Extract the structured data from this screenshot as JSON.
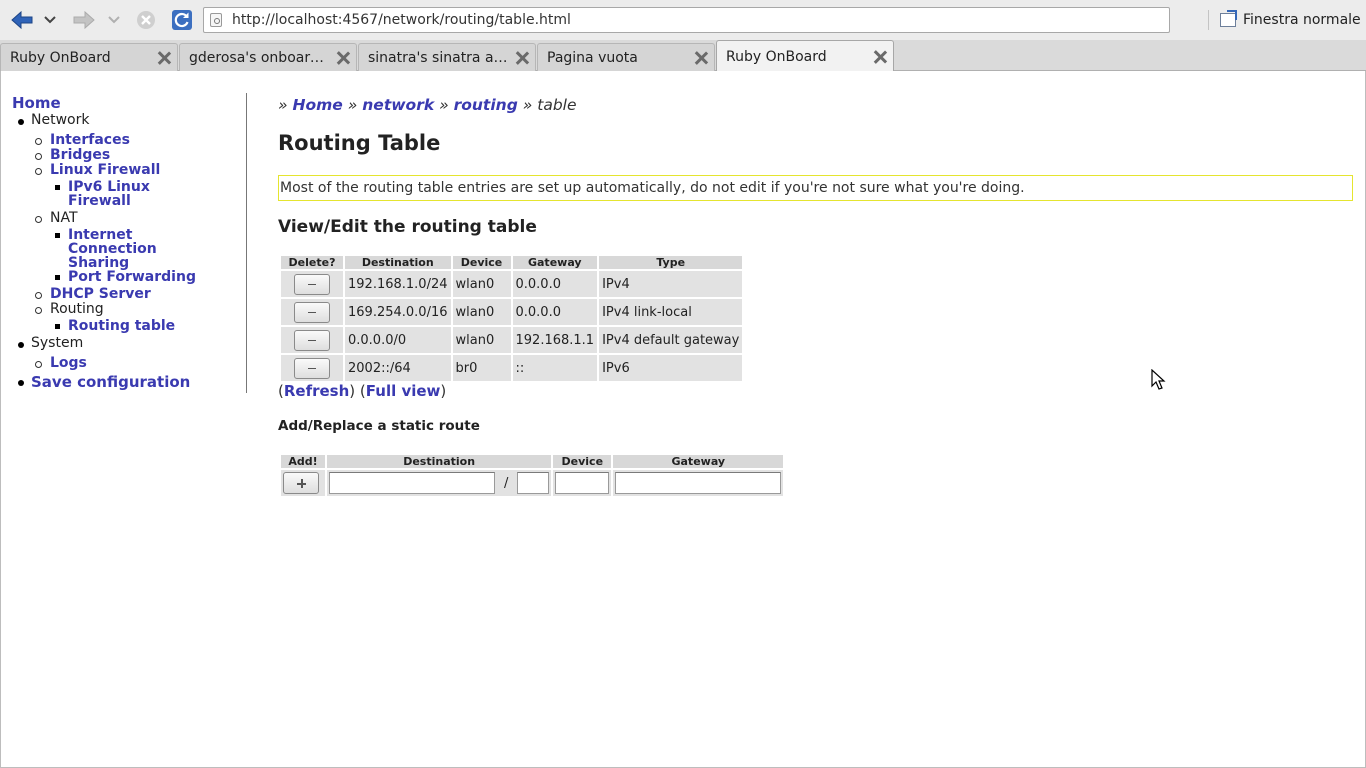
{
  "browser": {
    "url": "http://localhost:4567/network/routing/table.html",
    "window_mode_label": "Finestra normale",
    "tabs": [
      {
        "title": "Ruby OnBoard",
        "active": false
      },
      {
        "title": "gderosa's onboard at master - GitHub",
        "active": false
      },
      {
        "title": "sinatra's sinatra at master - GitHub",
        "active": false
      },
      {
        "title": "Pagina vuota",
        "active": false
      },
      {
        "title": "Ruby OnBoard",
        "active": true
      }
    ]
  },
  "sidebar": {
    "home": "Home",
    "network": "Network",
    "interfaces": "Interfaces",
    "bridges": "Bridges",
    "linux_firewall": "Linux Firewall",
    "ipv6_firewall_1": "IPv6 Linux",
    "ipv6_firewall_2": "Firewall",
    "nat": "NAT",
    "ics_1": "Internet",
    "ics_2": "Connection",
    "ics_3": "Sharing",
    "port_forwarding": "Port Forwarding",
    "dhcp_server": "DHCP Server",
    "routing": "Routing",
    "routing_table": "Routing table",
    "system": "System",
    "logs": "Logs",
    "save_configuration": "Save configuration"
  },
  "breadcrumb": {
    "sep": "»",
    "home": "Home",
    "network": "network",
    "routing": "routing",
    "current": "table"
  },
  "main": {
    "title": "Routing Table",
    "notice": "Most of the routing table entries are set up automatically, do not edit if you're not sure what you're doing.",
    "view_edit_title": "View/Edit the routing table",
    "refresh_label": "Refresh",
    "full_view_label": "Full view",
    "add_title": "Add/Replace a static route"
  },
  "routing_table": {
    "headers": [
      "Delete?",
      "Destination",
      "Device",
      "Gateway",
      "Type"
    ],
    "rows": [
      {
        "destination": "192.168.1.0/24",
        "device": "wlan0",
        "gateway": "0.0.0.0",
        "type": "IPv4"
      },
      {
        "destination": "169.254.0.0/16",
        "device": "wlan0",
        "gateway": "0.0.0.0",
        "type": "IPv4 link-local"
      },
      {
        "destination": "0.0.0.0/0",
        "device": "wlan0",
        "gateway": "192.168.1.1",
        "type": "IPv4 default gateway"
      },
      {
        "destination": "2002::/64",
        "device": "br0",
        "gateway": "::",
        "type": "IPv6"
      }
    ]
  },
  "add_route": {
    "headers": [
      "Add!",
      "Destination",
      "Device",
      "Gateway"
    ],
    "slash": "/",
    "destination_value": "",
    "prefix_value": "",
    "device_value": "",
    "gateway_value": ""
  }
}
